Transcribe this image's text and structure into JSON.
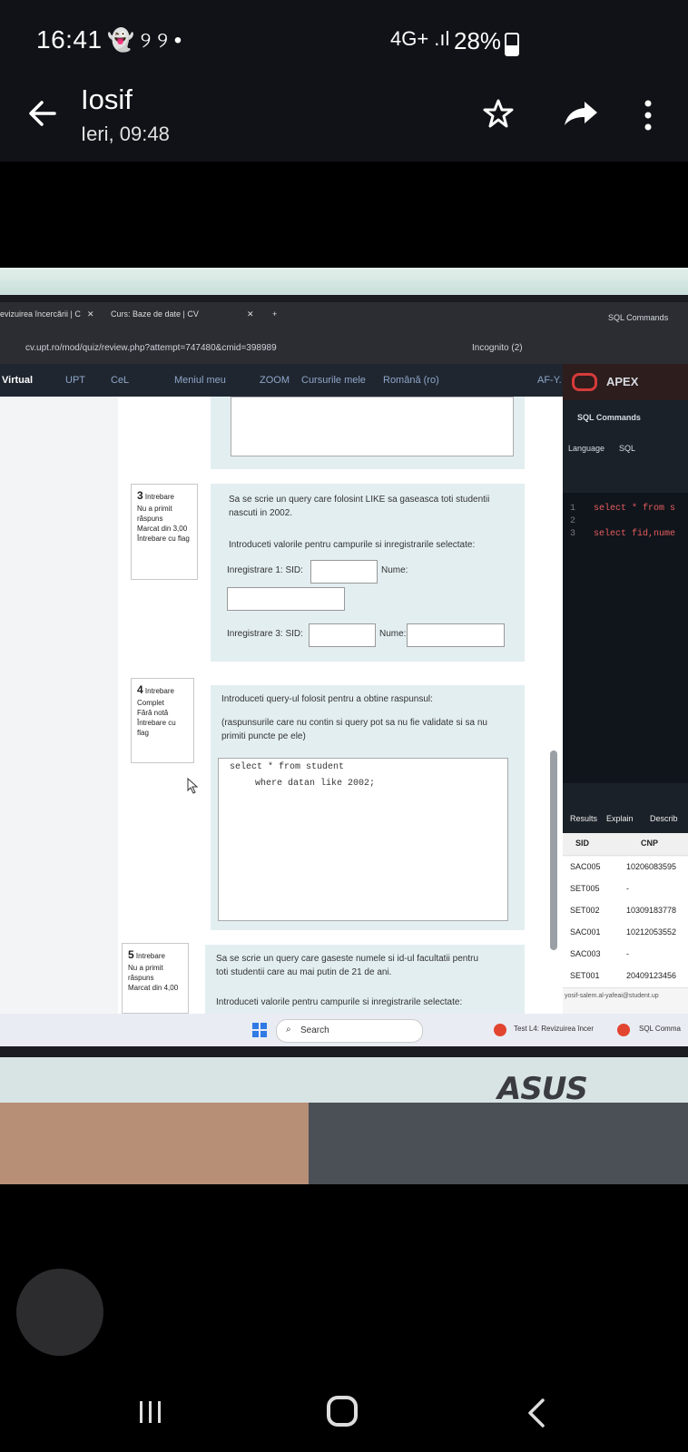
{
  "status_bar": {
    "time": "16:41",
    "left_icons": "👻 ୨ ୨ •",
    "network": "4G+ .ıl",
    "battery": "28%"
  },
  "app_bar": {
    "title": "Iosif",
    "subtitle": "Ieri, 09:48",
    "icons": [
      "back-arrow-icon",
      "star-icon",
      "share-icon",
      "more-vert-icon"
    ]
  },
  "photo": {
    "browser": {
      "tabs": [
        "evizuirea încercării | C",
        "Curs: Baze de date | CV"
      ],
      "url": "cv.upt.ro/mod/quiz/review.php?attempt=747480&cmid=398989",
      "incognito": "Incognito (2)",
      "bookmarks": [
        "Virtual",
        "UPT",
        "CeL",
        "Meniul meu",
        "ZOOM",
        "Cursurile mele",
        "Română (ro)",
        "AF-Y."
      ]
    },
    "questions": [
      {
        "number": "3",
        "label": "Intrebare",
        "state": "Nu a primit răspuns",
        "mark": "Marcat din 3,00",
        "flag": "Întrebare cu flag",
        "text": "Sa se scrie un query care folosint LIKE sa gaseasca toti studentii nascuti in 2002.",
        "instruction": "Introduceti valorile pentru campurile si inregistrarile selectate:",
        "row1": "Inregistrare 1: SID:",
        "name_label": "Nume:",
        "row3": "Inregistrare 3: SID:",
        "name_label3": "Nume:"
      },
      {
        "number": "4",
        "label": "Intrebare",
        "state": "Complet",
        "mark": "Fără notă",
        "flag": "Întrebare cu flag",
        "text": "Introduceti query-ul folosit pentru a obtine raspunsul:",
        "note": "(raspunsurile care nu contin si query pot sa nu fie validate si sa nu primiti puncte pe ele)",
        "code1": "select * from student",
        "code2": "where datan like 2002;"
      },
      {
        "number": "5",
        "label": "Intrebare",
        "state": "Nu a primit răspuns",
        "mark": "Marcat din 4,00",
        "text": "Sa se scrie un query care gaseste numele si id-ul facultatii pentru toti studentii care au mai putin de 21 de ani.",
        "instruction": "Introduceti valorile pentru campurile si inregistrarile selectate:"
      }
    ],
    "apex": {
      "tab": "SQL Commands",
      "brand": "APEX",
      "breadcrumb": "SQL Commands",
      "language_label": "Language",
      "language_value": "SQL",
      "code_lines": [
        {
          "n": "1",
          "text": "select * from s"
        },
        {
          "n": "2",
          "text": ""
        },
        {
          "n": "3",
          "text": "select fid,nume"
        }
      ],
      "result_tabs": [
        "Results",
        "Explain",
        "Describ"
      ],
      "columns": [
        "SID",
        "CNP"
      ],
      "rows": [
        [
          "SAC005",
          "10206083595"
        ],
        [
          "SET005",
          "-"
        ],
        [
          "SET002",
          "10309183778"
        ],
        [
          "SAC001",
          "10212053552"
        ],
        [
          "SAC003",
          "-"
        ],
        [
          "SET001",
          "20409123456"
        ]
      ],
      "footer": "yosif-salem.al-yafeai@student.up"
    },
    "taskbar": {
      "search": "Search",
      "app1": "Test L4: Revizuirea încer",
      "app2": "SQL Comma"
    },
    "brand": "ASUS"
  }
}
